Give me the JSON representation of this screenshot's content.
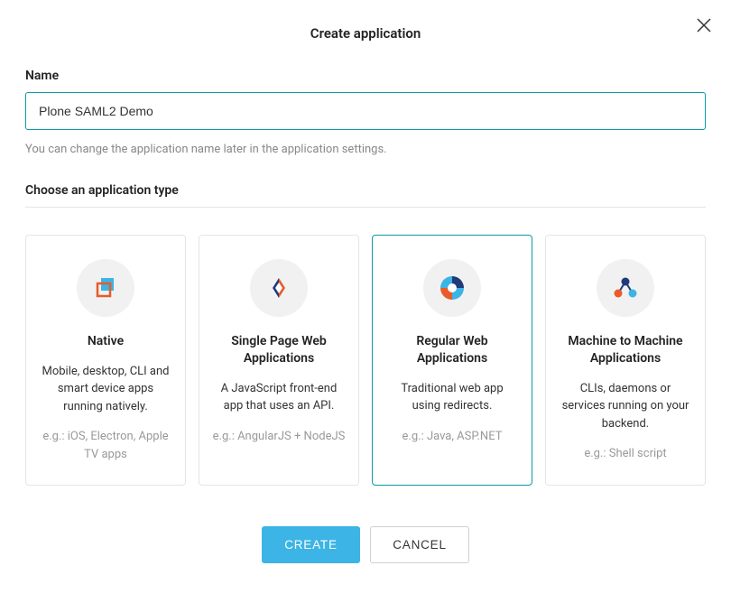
{
  "modal": {
    "title": "Create application",
    "close_icon": "close"
  },
  "name_field": {
    "label": "Name",
    "value": "Plone SAML2 Demo",
    "help": "You can change the application name later in the application settings."
  },
  "type_section": {
    "label": "Choose an application type",
    "selected_index": 2,
    "options": [
      {
        "icon": "native-icon",
        "title": "Native",
        "desc": "Mobile, desktop, CLI and smart device apps running natively.",
        "eg": "e.g.: iOS, Electron, Apple TV apps"
      },
      {
        "icon": "spa-icon",
        "title": "Single Page Web Applications",
        "desc": "A JavaScript front-end app that uses an API.",
        "eg": "e.g.: AngularJS + NodeJS"
      },
      {
        "icon": "regular-web-icon",
        "title": "Regular Web Applications",
        "desc": "Traditional web app using redirects.",
        "eg": "e.g.: Java, ASP.NET"
      },
      {
        "icon": "m2m-icon",
        "title": "Machine to Machine Applications",
        "desc": "CLIs, daemons or services running on your backend.",
        "eg": "e.g.: Shell script"
      }
    ]
  },
  "footer": {
    "create_label": "CREATE",
    "cancel_label": "CANCEL"
  }
}
